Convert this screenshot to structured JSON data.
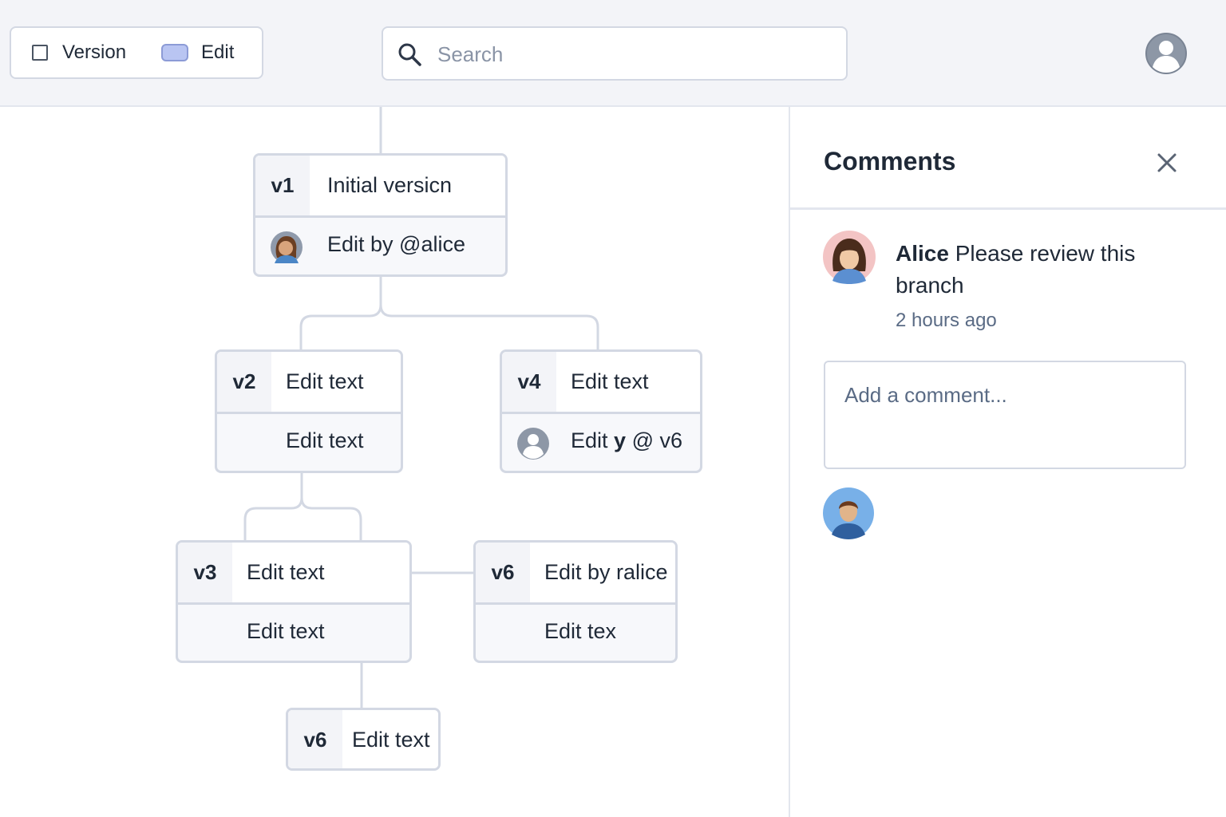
{
  "toolbar": {
    "version_label": "Version",
    "edit_label": "Edit",
    "search_placeholder": "Search"
  },
  "tree": {
    "nodes": [
      {
        "id": "v1",
        "tag": "v1",
        "title": "Initial versicn",
        "subtitle": "Edit by @alice"
      },
      {
        "id": "v2",
        "tag": "v2",
        "title": "Edit text",
        "subtitle": "Edit text"
      },
      {
        "id": "v4",
        "tag": "v4",
        "title": "Edit text",
        "subtitle_prefix": "Edit ",
        "subtitle_bold": "y",
        "subtitle_suffix": " @ v6"
      },
      {
        "id": "v3",
        "tag": "v3",
        "title": "Edit text",
        "subtitle": "Edit text"
      },
      {
        "id": "v6a",
        "tag": "v6",
        "title": "Edit by ralice",
        "subtitle": "Edit tex"
      },
      {
        "id": "v6b",
        "tag": "v6",
        "title": "Edit text"
      }
    ]
  },
  "comments": {
    "title": "Comments",
    "items": [
      {
        "author": "Alice",
        "text": " Please review this branch",
        "time": "2 hours ago"
      }
    ],
    "input_placeholder": "Add a comment..."
  },
  "colors": {
    "accent_toggle": "#b9c5f2",
    "border": "#d3d8e3",
    "muted_text": "#5a6b85",
    "topbar_bg": "#f3f4f8"
  },
  "icons": {
    "search": "search-icon",
    "profile": "user-avatar-icon",
    "close": "close-icon"
  }
}
